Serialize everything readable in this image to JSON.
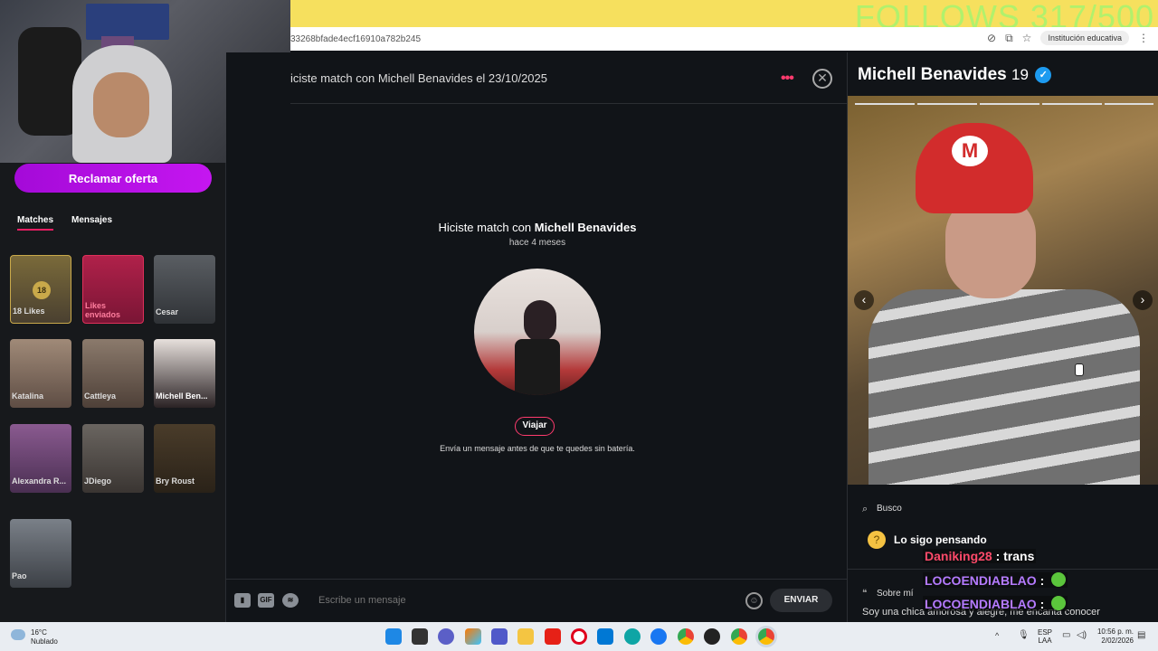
{
  "stream": {
    "follows_text": "FOLLOWS 317/500",
    "claim_offer": "Reclamar oferta"
  },
  "browser": {
    "url": "33268bfade4ecf16910a782b245",
    "profile_label": "Institución educativa"
  },
  "left_panel": {
    "tabs": [
      "Matches",
      "Mensajes"
    ],
    "likes_count": "18",
    "cards": [
      {
        "label": "18 Likes"
      },
      {
        "label": "Likes enviados"
      },
      {
        "label": "Cesar"
      },
      {
        "label": "Katalina"
      },
      {
        "label": "Cattleya"
      },
      {
        "label": "Michell Ben..."
      },
      {
        "label": "Alexandra R..."
      },
      {
        "label": "JDiego"
      },
      {
        "label": "Bry Roust"
      },
      {
        "label": "Pao"
      }
    ]
  },
  "chat": {
    "header": "iciste match con Michell Benavides el 23/10/2025",
    "match_prefix": "Hiciste match con ",
    "match_name": "Michell Benavides",
    "match_time": "hace 4 meses",
    "travel_label": "Viajar",
    "battery_hint": "Envía un mensaje antes de que te quedes sin batería.",
    "input_placeholder": "Escribe un mensaje",
    "send_label": "ENVIAR",
    "gif_label": "GIF"
  },
  "profile": {
    "name": "Michell Benavides",
    "age": "19",
    "looking_label": "Busco",
    "looking_value": "Lo sigo pensando",
    "about_label": "Sobre mí",
    "about_text": "Soy una chica amorosa y alegre, me encanta conocer"
  },
  "stream_chat": [
    {
      "user": "Daniking28",
      "text": ": trans"
    },
    {
      "user": "LOCOENDIABLAO",
      "text": ":"
    },
    {
      "user": "LOCOENDIABLAO",
      "text": ":"
    }
  ],
  "taskbar": {
    "temp": "16°C",
    "weather": "Nublado",
    "lang1": "ESP",
    "lang2": "LAA",
    "time": "10:56 p. m.",
    "date": "2/02/2026"
  },
  "colors": {
    "accent": "#e91e63",
    "claim": "#b10ee0",
    "streambar": "#f6e05e",
    "verified": "#1d9bf0"
  }
}
